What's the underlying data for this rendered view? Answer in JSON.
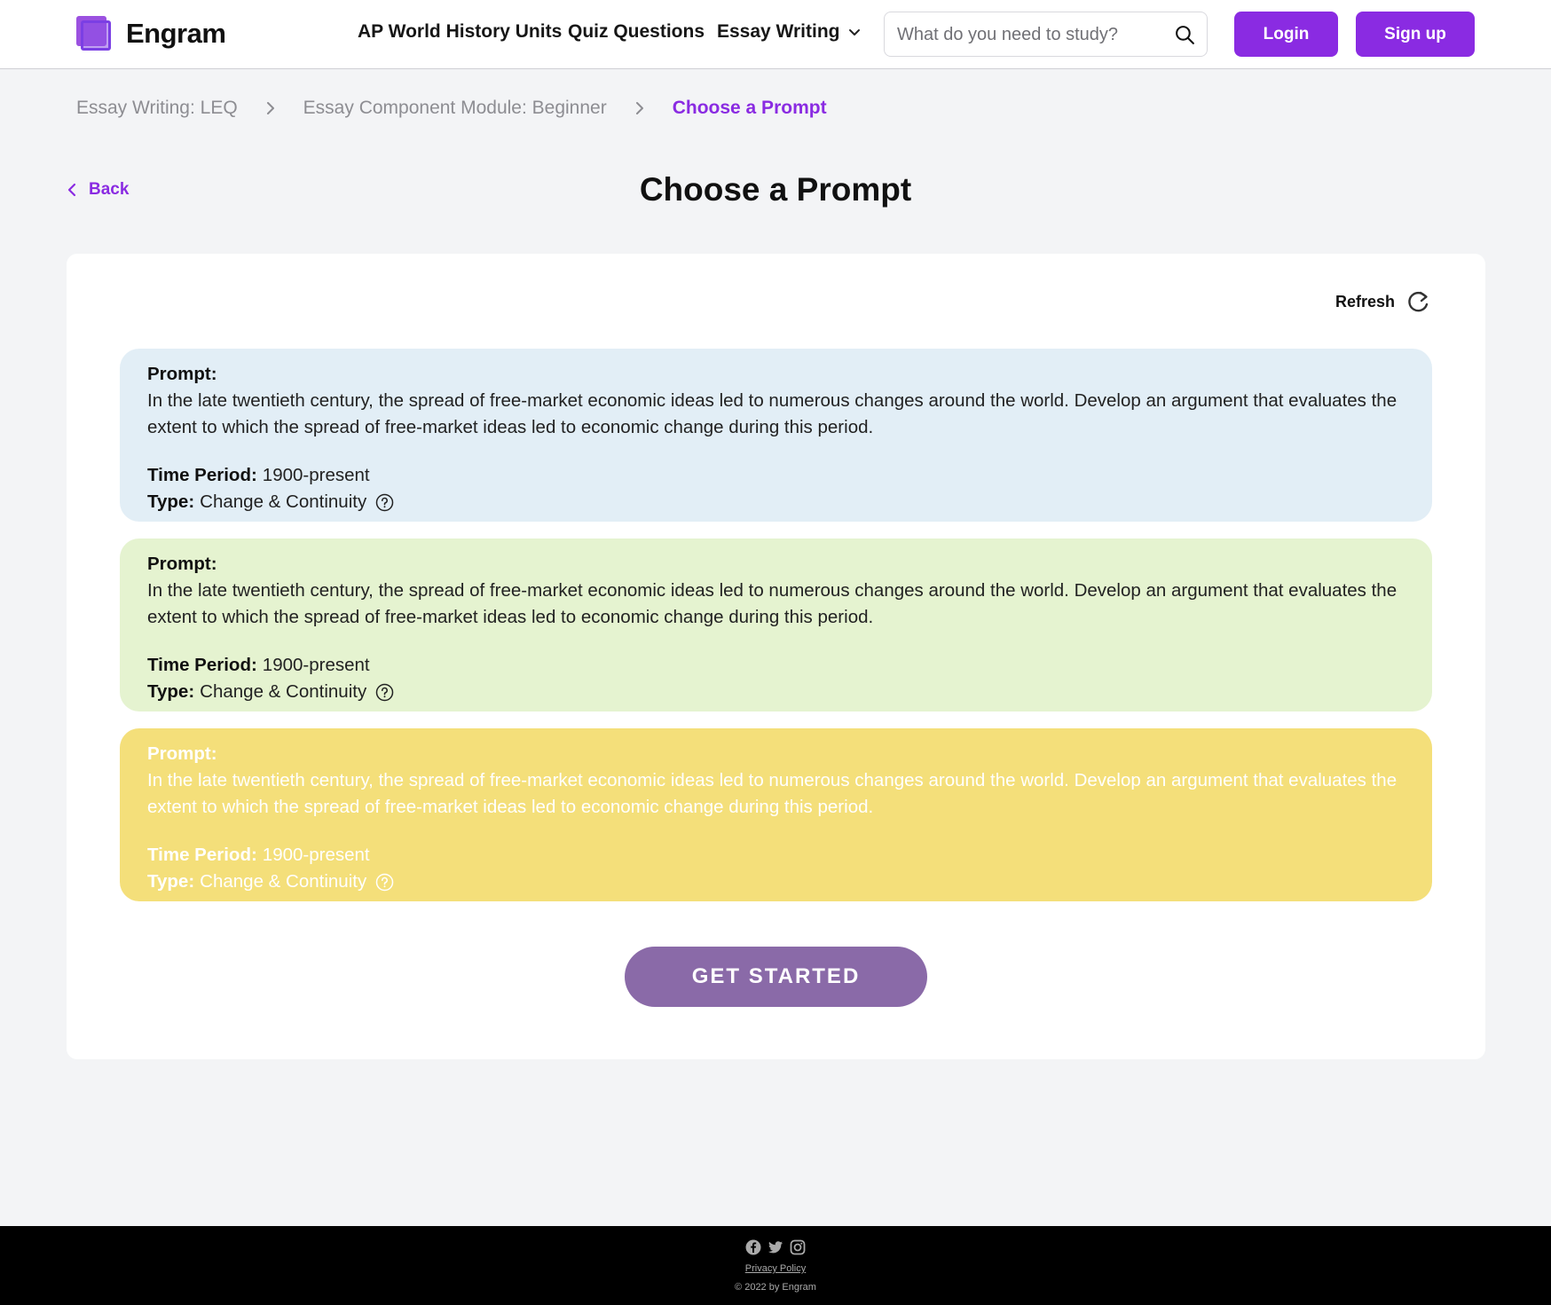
{
  "brand": {
    "name": "Engram",
    "accent": "#8a2be2"
  },
  "nav": {
    "units": "AP World History Units",
    "quiz": "Quiz Questions",
    "essay": "Essay Writing"
  },
  "search": {
    "placeholder": "What do you need to study?"
  },
  "auth": {
    "login": "Login",
    "signup": "Sign up"
  },
  "breadcrumb": [
    "Essay Writing: LEQ",
    "Essay Component Module: Beginner",
    "Choose a Prompt"
  ],
  "back_label": "Back",
  "page_title": "Choose a Prompt",
  "refresh_label": "Refresh",
  "prompts": [
    {
      "label": "Prompt:",
      "text": "In the late twentieth century, the spread of free-market economic ideas led to numerous changes around the world. Develop an argument that evaluates the extent to which the spread of free-market ideas led to economic change during this period.",
      "time_label": "Time Period:",
      "time_value": "1900-present",
      "type_label": "Type:",
      "type_value": "Change & Continuity",
      "color": "#e2eef6"
    },
    {
      "label": "Prompt:",
      "text": "In the late twentieth century, the spread of free-market economic ideas led to numerous changes around the world. Develop an argument that evaluates the extent to which the spread of free-market ideas led to economic change during this period.",
      "time_label": "Time Period:",
      "time_value": "1900-present",
      "type_label": "Type:",
      "type_value": "Change & Continuity",
      "color": "#e5f3d0"
    },
    {
      "label": "Prompt:",
      "text": "In the late twentieth century, the spread of free-market economic ideas led to numerous changes around the world. Develop an argument that evaluates the extent to which the spread of free-market ideas led to economic change during this period.",
      "time_label": "Time Period:",
      "time_value": "1900-present",
      "type_label": "Type:",
      "type_value": "Change & Continuity",
      "color": "#f4df7a"
    }
  ],
  "cta_label": "GET STARTED",
  "footer": {
    "icons": [
      "facebook-icon",
      "twitter-icon",
      "instagram-icon"
    ],
    "privacy": "Privacy Policy",
    "copyright": "© 2022 by Engram"
  }
}
